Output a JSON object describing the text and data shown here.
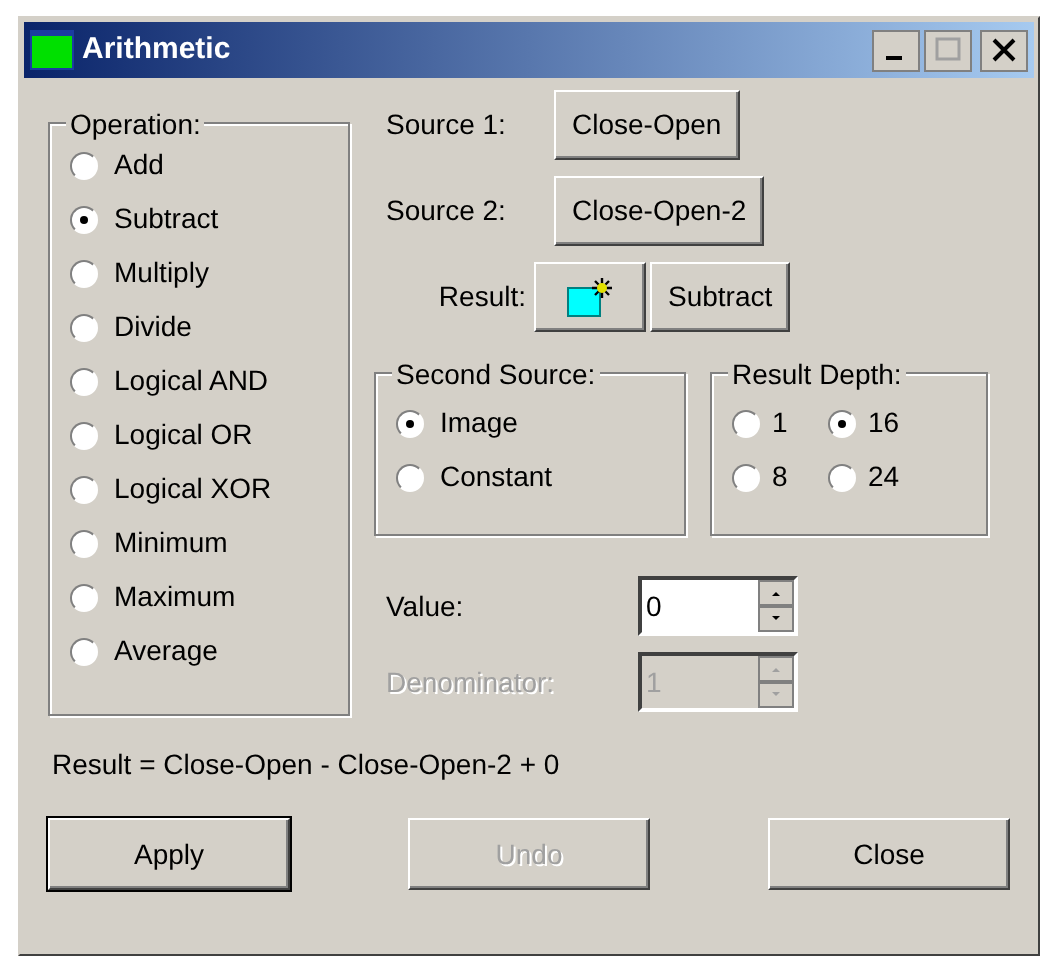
{
  "window": {
    "title": "Arithmetic"
  },
  "operation": {
    "label": "Operation:",
    "options": [
      {
        "label": "Add",
        "selected": false
      },
      {
        "label": "Subtract",
        "selected": true
      },
      {
        "label": "Multiply",
        "selected": false
      },
      {
        "label": "Divide",
        "selected": false
      },
      {
        "label": "Logical AND",
        "selected": false
      },
      {
        "label": "Logical OR",
        "selected": false
      },
      {
        "label": "Logical XOR",
        "selected": false
      },
      {
        "label": "Minimum",
        "selected": false
      },
      {
        "label": "Maximum",
        "selected": false
      },
      {
        "label": "Average",
        "selected": false
      }
    ]
  },
  "source_1": {
    "label": "Source 1:",
    "value": "Close-Open"
  },
  "source_2": {
    "label": "Source 2:",
    "value": "Close-Open-2"
  },
  "result": {
    "label": "Result:",
    "value": "Subtract"
  },
  "second_source": {
    "label": "Second Source:",
    "options": [
      {
        "label": "Image",
        "selected": true
      },
      {
        "label": "Constant",
        "selected": false
      }
    ]
  },
  "result_depth": {
    "label": "Result Depth:",
    "options": [
      {
        "label": "1",
        "selected": false
      },
      {
        "label": "16",
        "selected": true
      },
      {
        "label": "8",
        "selected": false
      },
      {
        "label": "24",
        "selected": false
      }
    ]
  },
  "fields": [
    {
      "label": "Value:",
      "value": "0",
      "disabled": false
    },
    {
      "label": "Denominator:",
      "value": "1",
      "disabled": true
    }
  ],
  "formula": "Result = Close-Open - Close-Open-2 + 0",
  "buttons": [
    {
      "label": "Apply",
      "disabled": false,
      "default": true
    },
    {
      "label": "Undo",
      "disabled": true,
      "default": false
    },
    {
      "label": "Close",
      "disabled": false,
      "default": false
    }
  ]
}
